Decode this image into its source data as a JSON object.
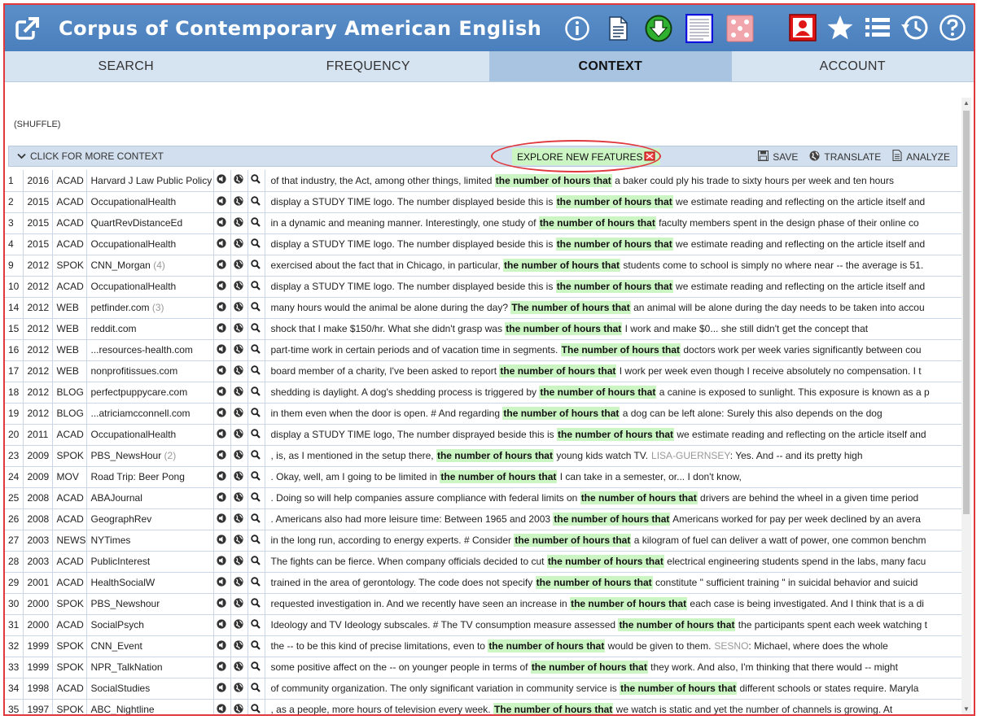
{
  "header": {
    "title": "Corpus of Contemporary American English",
    "colors": {
      "bar": "#4a7fbd",
      "active_tab": "#a9c4e1",
      "highlight": "#ccf5c4",
      "annotation": "#e0383c"
    }
  },
  "tabs": [
    {
      "label": "SEARCH"
    },
    {
      "label": "FREQUENCY"
    },
    {
      "label": "CONTEXT",
      "active": true
    },
    {
      "label": "ACCOUNT"
    }
  ],
  "shuffle_label": "(SHUFFLE)",
  "toolbar": {
    "more_context": "CLICK FOR MORE CONTEXT",
    "explore": "EXPLORE NEW FEATURES",
    "save": "SAVE",
    "translate": "TRANSLATE",
    "analyze": "ANALYZE"
  },
  "rows": [
    {
      "num": "1",
      "year": "2016",
      "genre": "ACAD",
      "source": "Harvard J Law Public Policy",
      "count": "",
      "pre": "of that industry, the Act, among other things, limited",
      "kw": "the number of hours that",
      "post": "a baker could ply his trade to sixty hours per week and ten hours"
    },
    {
      "num": "2",
      "year": "2015",
      "genre": "ACAD",
      "source": "OccupationalHealth",
      "count": "",
      "pre": "display a STUDY TIME logo. The number displayed beside this is",
      "kw": "the number of hours that",
      "post": "we estimate reading and reflecting on the article itself and"
    },
    {
      "num": "3",
      "year": "2015",
      "genre": "ACAD",
      "source": "QuartRevDistanceEd",
      "count": "",
      "pre": "in a dynamic and meaning manner. Interestingly, one study of",
      "kw": "the number of hours that",
      "post": "faculty members spent in the design phase of their online co"
    },
    {
      "num": "4",
      "year": "2015",
      "genre": "ACAD",
      "source": "OccupationalHealth",
      "count": "",
      "pre": "display a STUDY TIME logo. The number displayed beside this is",
      "kw": "the number of hours that",
      "post": "we estimate reading and reflecting on the article itself and"
    },
    {
      "num": "9",
      "year": "2012",
      "genre": "SPOK",
      "source": "CNN_Morgan",
      "count": "(4)",
      "pre": "exercised about the fact that in Chicago, in particular,",
      "kw": "the number of hours that",
      "post": "students come to school is simply no where near -- the average is 51."
    },
    {
      "num": "10",
      "year": "2012",
      "genre": "ACAD",
      "source": "OccupationalHealth",
      "count": "",
      "pre": "display a STUDY TIME logo. The number displayed beside this is",
      "kw": "the number of hours that",
      "post": "we estimate reading and reflecting on the article itself and"
    },
    {
      "num": "14",
      "year": "2012",
      "genre": "WEB",
      "source": "petfinder.com",
      "count": "(3)",
      "pre": "many hours would the animal be alone during the day?",
      "kw": "The number of hours that",
      "post": "an animal will be alone during the day needs to be taken into accou"
    },
    {
      "num": "15",
      "year": "2012",
      "genre": "WEB",
      "source": "reddit.com",
      "count": "",
      "pre": "shock that I make $150/hr. What she didn't grasp was",
      "kw": "the number of hours that",
      "post": "I work and make $0... she still didn't get the concept that"
    },
    {
      "num": "16",
      "year": "2012",
      "genre": "WEB",
      "source": "...resources-health.com",
      "count": "",
      "pre": "part-time work in certain periods and of vacation time in segments.",
      "kw": "The number of hours that",
      "post": "doctors work per week varies significantly between cou"
    },
    {
      "num": "17",
      "year": "2012",
      "genre": "WEB",
      "source": "nonprofitissues.com",
      "count": "",
      "pre": "board member of a charity, I've been asked to report",
      "kw": "the number of hours that",
      "post": "I work per week even though I receive absolutely no compensation. I t"
    },
    {
      "num": "18",
      "year": "2012",
      "genre": "BLOG",
      "source": "perfectpuppycare.com",
      "count": "",
      "pre": "shedding is daylight. A dog's shedding process is triggered by",
      "kw": "the number of hours that",
      "post": "a canine is exposed to sunlight. This exposure is known as a p"
    },
    {
      "num": "19",
      "year": "2012",
      "genre": "BLOG",
      "source": "...atriciamcconnell.com",
      "count": "",
      "pre": "in them even when the door is open. # And regarding",
      "kw": "the number of hours that",
      "post": "a dog can be left alone: Surely this also depends on the dog"
    },
    {
      "num": "20",
      "year": "2011",
      "genre": "ACAD",
      "source": "OccupationalHealth",
      "count": "",
      "pre": "display a STUDY TIME logo, The number disprayed beside this is",
      "kw": "the number of hours that",
      "post": "we estimate reading and reflecting on the article itself and"
    },
    {
      "num": "23",
      "year": "2009",
      "genre": "SPOK",
      "source": "PBS_NewsHour",
      "count": "(2)",
      "pre": ", is, as I mentioned in the setup there,",
      "kw": "the number of hours that",
      "post": "young kids watch TV.",
      "speaker": "LISA-GUERNSEY",
      "post2": ": Yes. And -- and its pretty high"
    },
    {
      "num": "24",
      "year": "2009",
      "genre": "MOV",
      "source": "Road Trip: Beer Pong",
      "count": "",
      "pre": ". Okay, well, am I going to be limited in",
      "kw": "the number of hours that",
      "post": "I can take in a semester, or... I don't know,"
    },
    {
      "num": "25",
      "year": "2008",
      "genre": "ACAD",
      "source": "ABAJournal",
      "count": "",
      "pre": ". Doing so will help companies assure compliance with federal limits on",
      "kw": "the number of hours that",
      "post": "drivers are behind the wheel in a given time period"
    },
    {
      "num": "26",
      "year": "2008",
      "genre": "ACAD",
      "source": "GeographRev",
      "count": "",
      "pre": ". Americans also had more leisure time: Between 1965 and 2003",
      "kw": "the number of hours that",
      "post": "Americans worked for pay per week declined by an avera"
    },
    {
      "num": "27",
      "year": "2003",
      "genre": "NEWS",
      "source": "NYTimes",
      "count": "",
      "pre": "in the long run, according to energy experts. # Consider",
      "kw": "the number of hours that",
      "post": "a kilogram of fuel can deliver a watt of power, one common benchm"
    },
    {
      "num": "28",
      "year": "2003",
      "genre": "ACAD",
      "source": "PublicInterest",
      "count": "",
      "pre": "The fights can be fierce. When company officials decided to cut",
      "kw": "the number of hours that",
      "post": "electrical engineering students spend in the labs, many facu"
    },
    {
      "num": "29",
      "year": "2001",
      "genre": "ACAD",
      "source": "HealthSocialW",
      "count": "",
      "pre": "trained in the area of gerontology. The code does not specify",
      "kw": "the number of hours that",
      "post": "constitute \" sufficient training \" in suicidal behavior and suicid"
    },
    {
      "num": "30",
      "year": "2000",
      "genre": "SPOK",
      "source": "PBS_Newshour",
      "count": "",
      "pre": "requested investigation in. And we recently have seen an increase in",
      "kw": "the number of hours that",
      "post": "each case is being investigated. And I think that is a di"
    },
    {
      "num": "31",
      "year": "2000",
      "genre": "ACAD",
      "source": "SocialPsych",
      "count": "",
      "pre": "Ideology and TV Ideology subscales. # The TV consumption measure assessed",
      "kw": "the number of hours that",
      "post": "the participants spent each week watching t"
    },
    {
      "num": "32",
      "year": "1999",
      "genre": "SPOK",
      "source": "CNN_Event",
      "count": "",
      "pre": "the -- to be this kind of precise limitations, even to",
      "kw": "the number of hours that",
      "post": "would be given to them.",
      "speaker": "SESNO",
      "post2": ": Michael, where does the whole"
    },
    {
      "num": "33",
      "year": "1999",
      "genre": "SPOK",
      "source": "NPR_TalkNation",
      "count": "",
      "pre": "some positive affect on the -- on younger people in terms of",
      "kw": "the number of hours that",
      "post": "they work. And also, I'm thinking that there would -- might"
    },
    {
      "num": "34",
      "year": "1998",
      "genre": "ACAD",
      "source": "SocialStudies",
      "count": "",
      "pre": "of community organization. The only significant variation in community service is",
      "kw": "the number of hours that",
      "post": "different schools or states require. Maryla"
    },
    {
      "num": "35",
      "year": "1997",
      "genre": "SPOK",
      "source": "ABC_Nightline",
      "count": "",
      "pre": ", as a people, more hours of television every week.",
      "kw": "The number of hours that",
      "post": "we watch is static and yet the number of channels is growing. At"
    }
  ]
}
